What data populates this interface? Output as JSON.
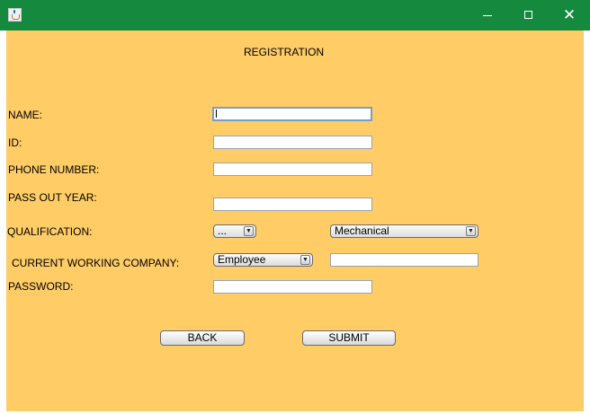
{
  "window": {
    "title": "",
    "icon": "java-icon",
    "controls": [
      "minimize-icon",
      "maximize-icon",
      "close-icon"
    ],
    "close_glyph": "✕"
  },
  "form": {
    "heading": "REGISTRATION",
    "labels": {
      "name": "NAME:",
      "id": "ID:",
      "phone": "PHONE NUMBER:",
      "pass_out_year": "PASS OUT YEAR:",
      "qualification": "QUALIFICATION:",
      "company": "CURRENT WORKING COMPANY:",
      "password": "PASSWORD:"
    },
    "values": {
      "name": "",
      "id": "",
      "phone": "",
      "pass_out_year": "",
      "company_name": "",
      "password": ""
    },
    "qualification_degree": "...",
    "qualification_branch": "Mechanical",
    "company_type": "Employee",
    "dropdown_arrow": "▼",
    "back_label": "BACK",
    "submit_label": "SUBMIT"
  },
  "colors": {
    "titlebar": "#158a3e",
    "background": "#ffcc66"
  }
}
